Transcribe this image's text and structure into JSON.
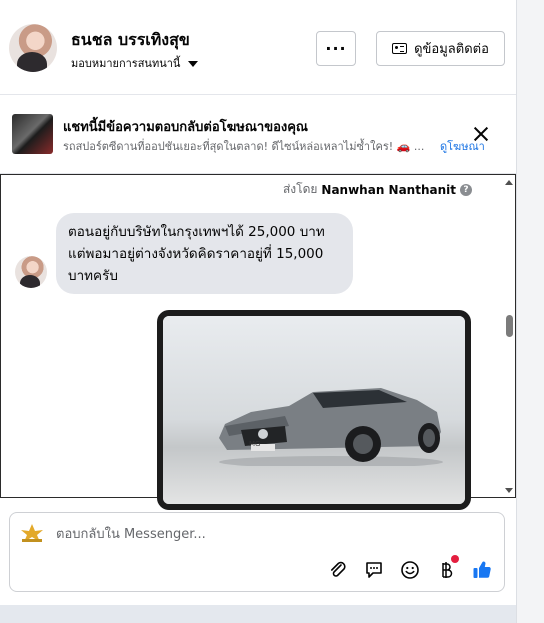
{
  "header": {
    "page_name": "ธนชล บรรเทิงสุข",
    "subtitle": "มอบหมายการสนทนานี้",
    "more_label": "···",
    "contact_label": "ดูข้อมูลติดต่อ"
  },
  "banner": {
    "title": "แชทนี้มีข้อความตอบกลับต่อโฆษณาของคุณ",
    "text": "รถสปอร์ตซีดานที่ออปชันเยอะที่สุดในตลาด! ดีไซน์หล่อเหลาไม่ซ้ำใคร! 🚗 ...",
    "link": "ดูโฆษณา"
  },
  "conversation": {
    "sent_by_prefix": "ส่งโดย",
    "sent_by_name": "Nanwhan Nanthanit",
    "info_symbol": "?",
    "message": "ตอนอยู่กับบริษัทในกรุงเทพฯได้ 25,000 บาทแต่พอมาอยู่ต่างจังหวัดคิดราคาอยู่ที่ 15,000 บาทครับ",
    "plate_text": "MG"
  },
  "reply": {
    "placeholder": "ตอบกลับใน Messenger..."
  },
  "colors": {
    "link_blue": "#1b74e4",
    "bubble_gray": "#e4e6eb",
    "like_blue": "#1877f2",
    "badge_red": "#e41e3f"
  },
  "icons": [
    "id-card-icon",
    "more-icon",
    "close-icon",
    "info-icon",
    "paperclip-icon",
    "saved-reply-icon",
    "emoji-icon",
    "baht-icon",
    "thumbs-up-icon",
    "caret-down-icon"
  ]
}
